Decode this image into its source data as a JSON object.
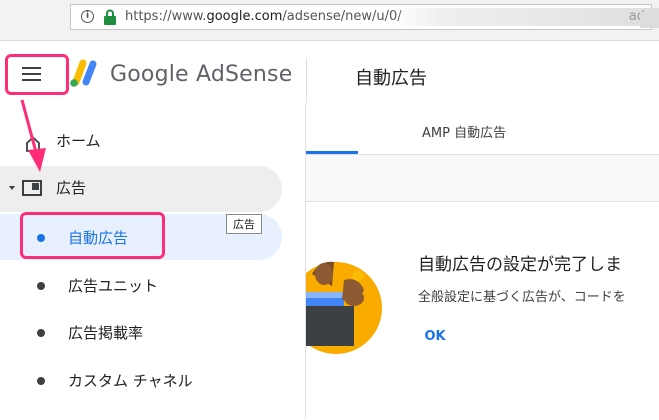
{
  "browser": {
    "url_prefix": "https://www.",
    "url_host": "google.com",
    "url_path": "/adsense/new/u/0/",
    "url_end": "ad"
  },
  "header": {
    "brand": "Google AdSense",
    "page_title": "自動広告"
  },
  "sidebar": {
    "items": [
      {
        "label": "ホーム"
      },
      {
        "label": "広告"
      },
      {
        "label": "自動広告"
      },
      {
        "label": "広告ユニット"
      },
      {
        "label": "広告掲載率"
      },
      {
        "label": "カスタム チャネル"
      }
    ],
    "tooltip": "広告"
  },
  "main": {
    "tabs": [
      {
        "label": ""
      },
      {
        "label": "AMP 自動広告"
      }
    ],
    "card": {
      "title": "自動広告の設定が完了しま",
      "subtitle": "全般設定に基づく広告が、コードを",
      "ok_label": "OK"
    }
  },
  "colors": {
    "accent": "#1a73e8",
    "highlight": "#ff2d77",
    "illustration_bg": "#f9ab00"
  }
}
